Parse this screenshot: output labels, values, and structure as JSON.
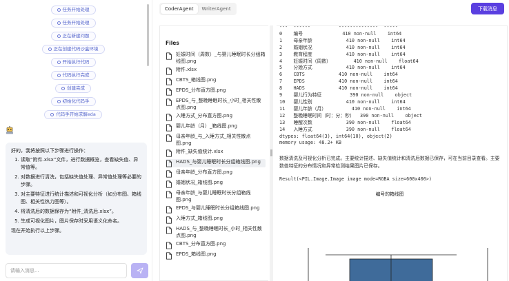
{
  "left": {
    "steps": [
      "任务开始处理",
      "任务开始处理",
      "正在新建问题",
      "正在创建代码沙盒环境",
      "开始执行代码",
      "代码执行完成",
      "创建完成",
      "初始化代码手",
      "代码手开始求解eda"
    ],
    "message": {
      "intro": "好的，我将按照以下步骤进行操作：",
      "items": [
        "读取“附件.xlsx”文件，进行数据概览，查看缺失值、异常值等。",
        "对数据进行清洗，包括缺失值处理、异常值处理等必要的步骤。",
        "对主要特征进行统计描述和可视化分析（如分布图、箱线图、相关性热力图等）。",
        "将清洗后的数据保存为“附件_清洗后.xlsx”。",
        "生成可视化图片，图片保存时采用语义化命名。"
      ],
      "outro": "现在开始执行以上步骤。"
    },
    "input_placeholder": "请输入消息..."
  },
  "right": {
    "tabs": [
      {
        "label": "CoderAgent"
      },
      {
        "label": "WriterAgent"
      }
    ],
    "download_label": "下载消息",
    "files_title": "Files",
    "files": [
      "妊娠时间（周数）_与婴儿睡眠时长分组箱线图.png",
      "附件.xlsx",
      "CBTS_箱线图.png",
      "EPDS_分布直方图.png",
      "EPDS_与_整晚睡眠时长_小时_相关性散点图.png",
      "入睡方式_分布直方图.png",
      "婴儿年龄（月）_箱线图.png",
      "母亲年龄_与_入睡方式_相关性散点图.png",
      "附件_缺失值统计.xlsx",
      "HADS_与婴儿睡眠时长分组箱线图.png",
      "母亲年龄_分布直方图.png",
      "婚姻状况_箱线图.png",
      "母亲年龄_与婴儿睡眠时长分组箱线图.png",
      "EPDS_与婴儿睡眠时长分组箱线图.png",
      "入睡方式_箱线图.png",
      "HADS_与_整晚睡眠时长_小时_相关性散点图.png",
      "CBTS_分布直方图.png",
      "EPDS_箱线图.png"
    ],
    "output": {
      "table_text": "---  ------          --------------  -----\n0    编号              410 non-null    int64\n1    母亲年龄            410 non-null    int64\n2    婚姻状况            410 non-null    int64\n3    教育程度            410 non-null    int64\n4    妊娠时间（周数）        410 non-null    float64\n5    分娩方式            410 non-null    int64\n6    CBTS            410 non-null    int64\n7    EPDS            410 non-null    int64\n8    HADS            410 non-null    int64\n9    婴儿行为特征          390 non-null    object\n10   婴儿性别            410 non-null    int64\n11   婴儿年龄（月）         410 non-null    int64\n12   整晚睡眠时间（时：分：秒）  390 non-null    object\n13   睡醒次数            390 non-null    float64\n14   入睡方式            390 non-null    float64\ndtypes: float64(3), int64(10), object(2)\nmemory usage: 48.2+ KB",
      "summary": "数据清洗及可视化分析已完成。主要统计描述、缺失值统计和清洗后数据已保存，可在当前目录查看。主要数值特征的分布情况和异常检测结果图片已保存。",
      "result": "Result(<PIL.Image.Image image mode=RGBA size=600x400>)",
      "chart_title": "编号的箱线图"
    }
  },
  "colors": {
    "accent": "#5a3fe0",
    "send_button": "#b9b2f4",
    "box_fill": "#3f6b9a",
    "step_text": "#5566cc"
  }
}
